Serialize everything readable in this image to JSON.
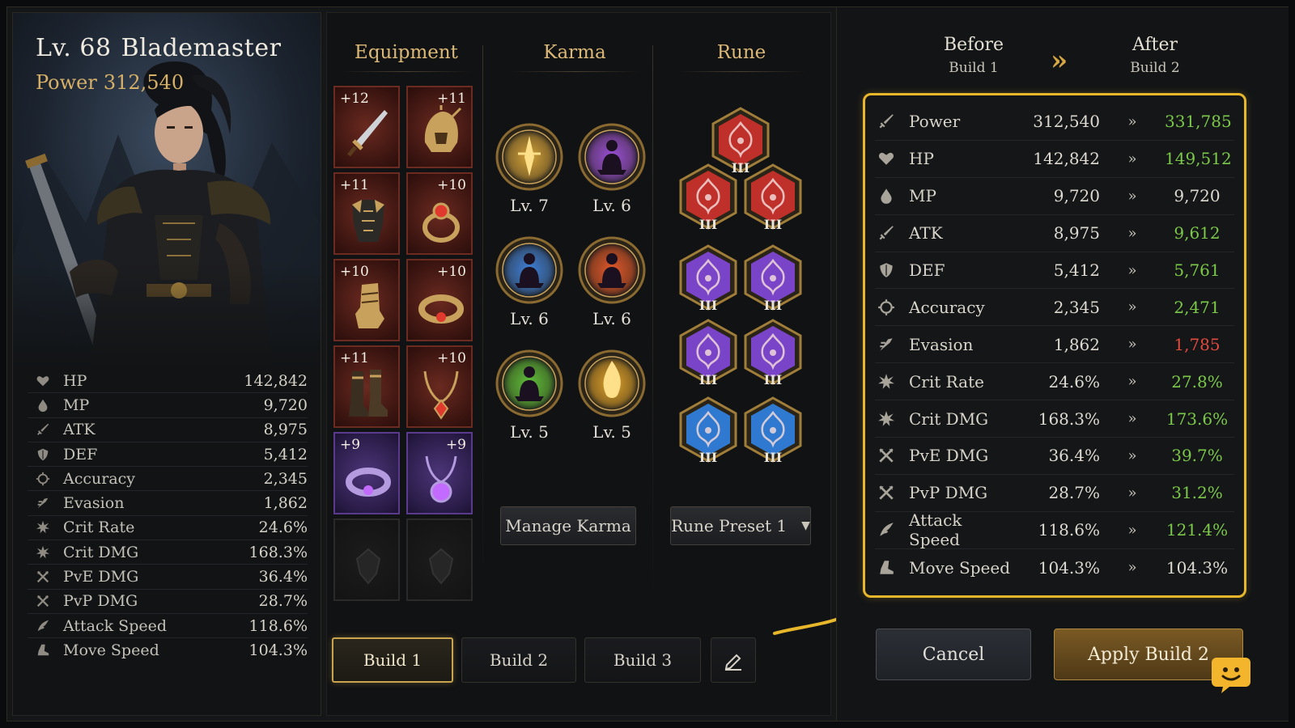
{
  "character": {
    "level": "Lv. 68",
    "class_name": "Blademaster",
    "power_label": "Power",
    "power_value": "312,540"
  },
  "stats": [
    {
      "icon": "heart-icon",
      "label": "HP",
      "value": "142,842"
    },
    {
      "icon": "drop-icon",
      "label": "MP",
      "value": "9,720"
    },
    {
      "icon": "sword-icon",
      "label": "ATK",
      "value": "8,975"
    },
    {
      "icon": "shield-icon",
      "label": "DEF",
      "value": "5,412"
    },
    {
      "icon": "crosshair-icon",
      "label": "Accuracy",
      "value": "2,345"
    },
    {
      "icon": "evasion-icon",
      "label": "Evasion",
      "value": "1,862"
    },
    {
      "icon": "burst-icon",
      "label": "Crit Rate",
      "value": "24.6%"
    },
    {
      "icon": "burst-icon",
      "label": "Crit DMG",
      "value": "168.3%"
    },
    {
      "icon": "crossed-swords-icon",
      "label": "PvE DMG",
      "value": "36.4%"
    },
    {
      "icon": "crossed-swords-icon",
      "label": "PvP DMG",
      "value": "28.7%"
    },
    {
      "icon": "wing-icon",
      "label": "Attack Speed",
      "value": "118.6%"
    },
    {
      "icon": "boot-icon",
      "label": "Move Speed",
      "value": "104.3%"
    }
  ],
  "columns": {
    "equipment": "Equipment",
    "karma": "Karma",
    "rune": "Rune"
  },
  "equipment": [
    {
      "name": "sword",
      "plus": "+12",
      "rarity": "red",
      "icon": "sword-item-icon"
    },
    {
      "name": "helmet",
      "plus": "+11",
      "rarity": "red",
      "icon": "helmet-item-icon"
    },
    {
      "name": "armor",
      "plus": "+11",
      "rarity": "red",
      "icon": "armor-item-icon"
    },
    {
      "name": "ring",
      "plus": "+10",
      "rarity": "red",
      "icon": "ring-item-icon"
    },
    {
      "name": "gauntlet",
      "plus": "+10",
      "rarity": "red",
      "icon": "gauntlet-item-icon"
    },
    {
      "name": "bracelet",
      "plus": "+10",
      "rarity": "red",
      "icon": "bracelet-item-icon"
    },
    {
      "name": "boots",
      "plus": "+11",
      "rarity": "red",
      "icon": "boots-item-icon"
    },
    {
      "name": "necklace",
      "plus": "+10",
      "rarity": "red",
      "icon": "necklace-item-icon"
    },
    {
      "name": "bracelet-purple",
      "plus": "+9",
      "rarity": "purple",
      "icon": "bracelet-item-icon"
    },
    {
      "name": "amulet-purple",
      "plus": "+9",
      "rarity": "purple",
      "icon": "amulet-item-icon"
    },
    {
      "name": "empty-slot-1",
      "plus": "",
      "rarity": "empty",
      "icon": "empty-slot-icon"
    },
    {
      "name": "empty-slot-2",
      "plus": "",
      "rarity": "empty",
      "icon": "empty-slot-icon"
    }
  ],
  "karma": [
    {
      "level": "Lv. 7",
      "color": "#d4a23a",
      "icon": "golden-blade-icon"
    },
    {
      "level": "Lv. 6",
      "color": "#9a4fd6",
      "icon": "meditate-icon"
    },
    {
      "level": "Lv. 6",
      "color": "#3e7fd8",
      "icon": "meditate-icon"
    },
    {
      "level": "Lv. 6",
      "color": "#e0572a",
      "icon": "meditate-icon"
    },
    {
      "level": "Lv. 5",
      "color": "#5fbf3a",
      "icon": "meditate-icon"
    },
    {
      "level": "Lv. 5",
      "color": "#e0a22a",
      "icon": "flame-icon"
    }
  ],
  "runes": [
    {
      "rank": "III",
      "color": "#c0302a"
    },
    {
      "rank": "III",
      "color": "#c0302a"
    },
    {
      "rank": "III",
      "color": "#c0302a"
    },
    {
      "rank": "III",
      "color": "#7a44c8"
    },
    {
      "rank": "III",
      "color": "#7a44c8"
    },
    {
      "rank": "III",
      "color": "#7a44c8"
    },
    {
      "rank": "III",
      "color": "#7a44c8"
    },
    {
      "rank": "III",
      "color": "#2f7ad0"
    },
    {
      "rank": "III",
      "color": "#2f7ad0"
    }
  ],
  "buttons": {
    "manage_karma": "Manage Karma",
    "rune_preset": "Rune Preset 1",
    "cancel": "Cancel",
    "apply": "Apply Build 2"
  },
  "builds": [
    "Build 1",
    "Build 2",
    "Build 3"
  ],
  "active_build": "Build 1",
  "compare": {
    "before_title": "Before",
    "before_build": "Build 1",
    "after_title": "After",
    "after_build": "Build 2",
    "rows": [
      {
        "icon": "sword-icon",
        "label": "Power",
        "before": "312,540",
        "after": "331,785",
        "trend": "up"
      },
      {
        "icon": "heart-icon",
        "label": "HP",
        "before": "142,842",
        "after": "149,512",
        "trend": "up"
      },
      {
        "icon": "drop-icon",
        "label": "MP",
        "before": "9,720",
        "after": "9,720",
        "trend": "same"
      },
      {
        "icon": "sword-icon",
        "label": "ATK",
        "before": "8,975",
        "after": "9,612",
        "trend": "up"
      },
      {
        "icon": "shield-icon",
        "label": "DEF",
        "before": "5,412",
        "after": "5,761",
        "trend": "up"
      },
      {
        "icon": "crosshair-icon",
        "label": "Accuracy",
        "before": "2,345",
        "after": "2,471",
        "trend": "up"
      },
      {
        "icon": "evasion-icon",
        "label": "Evasion",
        "before": "1,862",
        "after": "1,785",
        "trend": "down"
      },
      {
        "icon": "burst-icon",
        "label": "Crit Rate",
        "before": "24.6%",
        "after": "27.8%",
        "trend": "up"
      },
      {
        "icon": "burst-icon",
        "label": "Crit DMG",
        "before": "168.3%",
        "after": "173.6%",
        "trend": "up"
      },
      {
        "icon": "crossed-swords-icon",
        "label": "PvE DMG",
        "before": "36.4%",
        "after": "39.7%",
        "trend": "up"
      },
      {
        "icon": "crossed-swords-icon",
        "label": "PvP DMG",
        "before": "28.7%",
        "after": "31.2%",
        "trend": "up"
      },
      {
        "icon": "wing-icon",
        "label": "Attack Speed",
        "before": "118.6%",
        "after": "121.4%",
        "trend": "up"
      },
      {
        "icon": "boot-icon",
        "label": "Move Speed",
        "before": "104.3%",
        "after": "104.3%",
        "trend": "same"
      }
    ]
  },
  "colors": {
    "gold_accent": "#e8b62a",
    "increase": "#7cc94a",
    "decrease": "#e24a3e",
    "header_gold": "#dcb877"
  }
}
